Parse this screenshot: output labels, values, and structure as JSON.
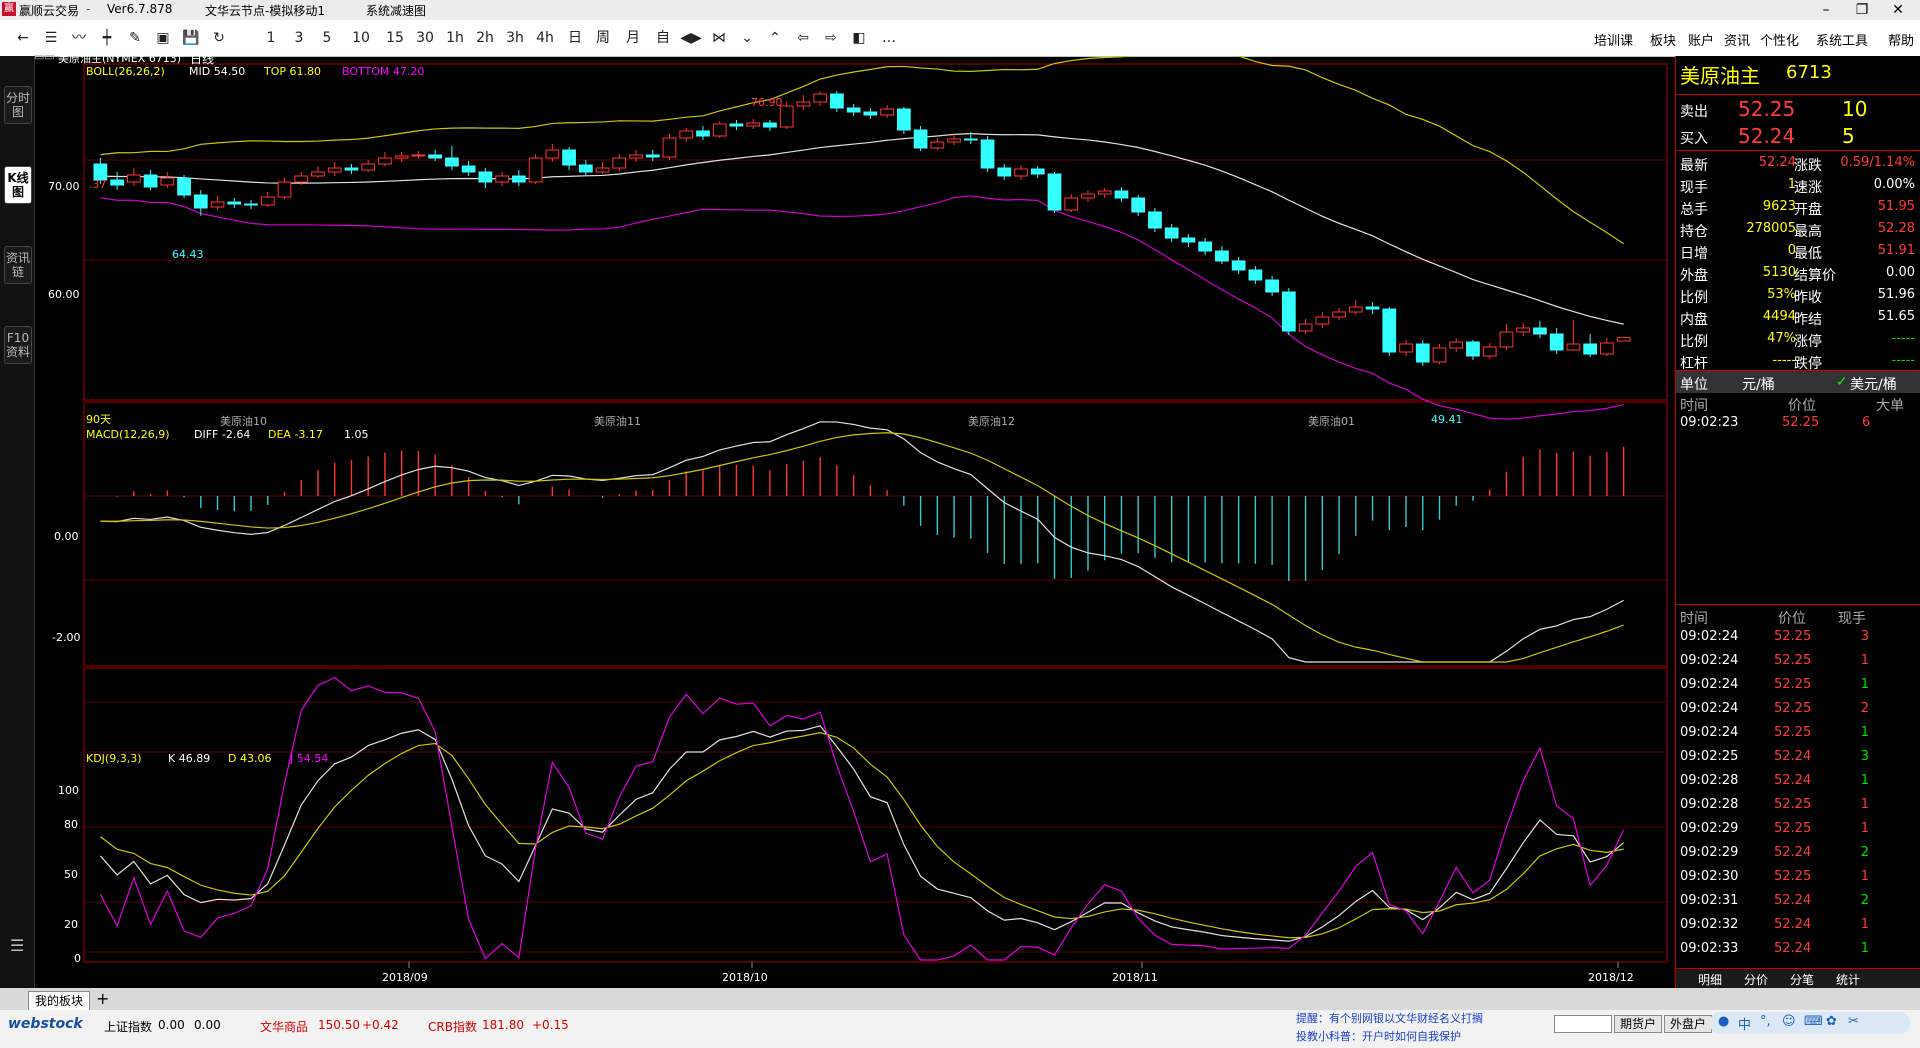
{
  "titlebar": {
    "app_name": "赢顺云交易",
    "version": "Ver6.7.878",
    "node": "文华云节点-模拟移动1",
    "status": "系统减速图"
  },
  "toolbar": {
    "periods": [
      "1",
      "3",
      "5",
      "10",
      "15",
      "30",
      "1h",
      "2h",
      "3h",
      "4h",
      "日",
      "周",
      "月",
      "自"
    ],
    "more": "…",
    "menu": [
      "培训课",
      "板块",
      "账户",
      "资讯",
      "个性化",
      "系统工具",
      "帮助"
    ]
  },
  "left_tabs": [
    "分时图",
    "K线图",
    "资讯链",
    "F10资料"
  ],
  "chart_header": {
    "symbol": "美原油主(NYMEX 6713)",
    "period": "日线"
  },
  "boll": {
    "label": "BOLL(26,26,2)",
    "mid": "MID 54.50",
    "top": "TOP 61.80",
    "bottom": "BOTTOM 47.20"
  },
  "macd": {
    "label": "MACD(12,26,9)",
    "diff": "DIFF -2.64",
    "dea": "DEA -3.17",
    "val": "1.05"
  },
  "kdj": {
    "label": "KDJ(9,3,3)",
    "k": "K 46.89",
    "d": "D 43.06",
    "j": "J 54.54"
  },
  "price_labels": {
    "y70": "70.00",
    "y60": "60.00",
    "hi": "76.90",
    "lo1": "64.43",
    "lo2": "49.41",
    "left": ".37",
    "days": "90天"
  },
  "contract_labels": [
    "美原油10",
    "美原油11",
    "美原油12",
    "美原油01"
  ],
  "macd_axis": [
    "0.00",
    "-2.00"
  ],
  "kdj_axis": [
    "100",
    "80",
    "50",
    "20",
    "0"
  ],
  "date_axis": [
    "2018/09",
    "2018/10",
    "2018/11",
    "2018/12"
  ],
  "quote": {
    "name": "美原油主",
    "code": "6713",
    "sell_label": "卖出",
    "sell_price": "52.25",
    "sell_vol": "10",
    "buy_label": "买入",
    "buy_price": "52.24",
    "buy_vol": "5",
    "rows": [
      [
        "最新",
        "52.24",
        "涨跌",
        "0.59/1.14%"
      ],
      [
        "现手",
        "1",
        "速涨",
        "0.00%"
      ],
      [
        "总手",
        "9623",
        "开盘",
        "51.95"
      ],
      [
        "持仓",
        "278005",
        "最高",
        "52.28"
      ],
      [
        "日增",
        "0",
        "最低",
        "51.91"
      ],
      [
        "外盘",
        "5130",
        "结算价",
        "0.00"
      ],
      [
        "比例",
        "53%",
        "昨收",
        "51.96"
      ],
      [
        "内盘",
        "4494",
        "昨结",
        "51.65"
      ],
      [
        "比例",
        "47%",
        "涨停",
        "-----"
      ],
      [
        "杠杆",
        "-----",
        "跌停",
        "-----"
      ]
    ],
    "unit_label": "单位",
    "unit1": "元/桶",
    "unit2": "美元/桶"
  },
  "big_trade": {
    "headers": [
      "时间",
      "价位",
      "大单"
    ],
    "rows": [
      [
        "09:02:23",
        "52.25",
        "6"
      ]
    ]
  },
  "ticks": {
    "headers": [
      "时间",
      "价位",
      "现手"
    ],
    "rows": [
      [
        "09:02:24",
        "52.25",
        "3",
        "r"
      ],
      [
        "09:02:24",
        "52.25",
        "1",
        "r"
      ],
      [
        "09:02:24",
        "52.25",
        "1",
        "g"
      ],
      [
        "09:02:24",
        "52.25",
        "2",
        "r"
      ],
      [
        "09:02:24",
        "52.25",
        "1",
        "g"
      ],
      [
        "09:02:25",
        "52.24",
        "3",
        "g"
      ],
      [
        "09:02:28",
        "52.24",
        "1",
        "g"
      ],
      [
        "09:02:28",
        "52.25",
        "1",
        "r"
      ],
      [
        "09:02:29",
        "52.25",
        "1",
        "r"
      ],
      [
        "09:02:29",
        "52.24",
        "2",
        "g"
      ],
      [
        "09:02:30",
        "52.25",
        "1",
        "r"
      ],
      [
        "09:02:31",
        "52.24",
        "2",
        "g"
      ],
      [
        "09:02:32",
        "52.24",
        "1",
        "r"
      ],
      [
        "09:02:33",
        "52.24",
        "1",
        "g"
      ]
    ]
  },
  "right_tabs": [
    "明细",
    "分价",
    "分笔",
    "统计"
  ],
  "bottom": {
    "tab": "我的板块",
    "add": "+",
    "brand": "webstock",
    "indexes": [
      {
        "name": "上证指数",
        "value": "0.00",
        "chg": "0.00"
      },
      {
        "name": "文华商品",
        "value": "150.50",
        "chg": "+0.42"
      },
      {
        "name": "CRB指数",
        "value": "181.80",
        "chg": "+0.15"
      }
    ],
    "notice1": "提醒：有个别网银以文华财经名义打搁",
    "notice2": "投教小科普：开户时如何自我保护",
    "btn1": "期货户",
    "btn2": "外盘户",
    "tray": [
      "中",
      "°,",
      "☺",
      "⌨",
      "✿",
      "✂"
    ]
  },
  "chart_data": {
    "type": "candlestick",
    "candles": [
      [
        69.6,
        68.0,
        70.2,
        67.6
      ],
      [
        68.0,
        67.5,
        68.8,
        67.0
      ],
      [
        67.8,
        68.5,
        69.2,
        67.4
      ],
      [
        68.5,
        67.3,
        69.0,
        67.0
      ],
      [
        67.5,
        68.2,
        68.8,
        67.2
      ],
      [
        68.2,
        66.5,
        68.5,
        66.2
      ],
      [
        66.5,
        65.2,
        67.0,
        64.43
      ],
      [
        65.3,
        65.8,
        66.4,
        65.0
      ],
      [
        65.8,
        65.6,
        66.2,
        65.2
      ],
      [
        65.6,
        65.5,
        66.0,
        65.1
      ],
      [
        65.5,
        66.3,
        66.8,
        65.3
      ],
      [
        66.3,
        67.8,
        68.2,
        66.1
      ],
      [
        67.8,
        68.4,
        68.8,
        67.5
      ],
      [
        68.4,
        68.8,
        69.4,
        68.2
      ],
      [
        68.8,
        69.2,
        69.8,
        68.4
      ],
      [
        69.2,
        69.0,
        69.6,
        68.6
      ],
      [
        69.0,
        69.6,
        70.0,
        68.8
      ],
      [
        69.6,
        70.2,
        70.8,
        69.4
      ],
      [
        70.2,
        70.4,
        70.8,
        69.8
      ],
      [
        70.4,
        70.5,
        70.9,
        70.1
      ],
      [
        70.5,
        70.2,
        71.0,
        69.9
      ],
      [
        70.2,
        69.4,
        71.4,
        69.0
      ],
      [
        69.4,
        68.8,
        69.9,
        68.4
      ],
      [
        68.8,
        67.8,
        69.2,
        67.2
      ],
      [
        67.8,
        68.4,
        68.8,
        67.4
      ],
      [
        68.4,
        67.8,
        69.0,
        67.4
      ],
      [
        67.8,
        70.2,
        70.6,
        67.6
      ],
      [
        70.2,
        71.0,
        71.6,
        69.8
      ],
      [
        71.0,
        69.5,
        71.3,
        69.0
      ],
      [
        69.5,
        68.8,
        70.0,
        68.4
      ],
      [
        68.8,
        69.2,
        69.8,
        68.6
      ],
      [
        69.2,
        70.2,
        70.6,
        68.9
      ],
      [
        70.2,
        70.5,
        71.0,
        69.8
      ],
      [
        70.5,
        70.3,
        71.0,
        69.9
      ],
      [
        70.3,
        72.2,
        72.6,
        70.0
      ],
      [
        72.2,
        72.9,
        73.2,
        71.8
      ],
      [
        72.9,
        72.4,
        73.4,
        72.0
      ],
      [
        72.4,
        73.6,
        73.9,
        72.2
      ],
      [
        73.6,
        73.4,
        74.0,
        73.0
      ],
      [
        73.4,
        73.7,
        74.1,
        73.1
      ],
      [
        73.7,
        73.3,
        74.0,
        72.9
      ],
      [
        73.3,
        75.4,
        75.8,
        73.1
      ],
      [
        75.4,
        75.8,
        76.5,
        75.0
      ],
      [
        75.8,
        76.6,
        76.9,
        75.4
      ],
      [
        76.6,
        75.2,
        76.9,
        74.8
      ],
      [
        75.2,
        74.8,
        75.6,
        74.4
      ],
      [
        74.8,
        74.5,
        75.2,
        74.1
      ],
      [
        74.5,
        75.1,
        75.5,
        74.2
      ],
      [
        75.1,
        73.0,
        75.3,
        72.6
      ],
      [
        73.0,
        71.2,
        73.4,
        70.9
      ],
      [
        71.2,
        71.8,
        72.2,
        71.0
      ],
      [
        71.8,
        72.1,
        72.6,
        71.5
      ],
      [
        72.1,
        72.0,
        72.8,
        71.6
      ],
      [
        72.0,
        69.2,
        72.4,
        68.8
      ],
      [
        69.2,
        68.4,
        69.6,
        68.0
      ],
      [
        68.4,
        69.1,
        69.5,
        68.0
      ],
      [
        69.1,
        68.6,
        69.4,
        68.2
      ],
      [
        68.6,
        65.0,
        68.8,
        64.7
      ],
      [
        65.0,
        66.2,
        66.6,
        64.8
      ],
      [
        66.2,
        66.6,
        67.0,
        65.8
      ],
      [
        66.6,
        66.9,
        67.2,
        66.2
      ],
      [
        66.9,
        66.2,
        67.3,
        65.8
      ],
      [
        66.2,
        64.8,
        66.5,
        64.4
      ],
      [
        64.8,
        63.2,
        65.2,
        62.8
      ],
      [
        63.2,
        62.2,
        63.6,
        61.8
      ],
      [
        62.2,
        61.8,
        62.6,
        61.3
      ],
      [
        61.8,
        60.9,
        62.2,
        60.5
      ],
      [
        60.9,
        59.9,
        61.4,
        59.6
      ],
      [
        59.9,
        59.0,
        60.3,
        58.6
      ],
      [
        59.0,
        58.0,
        59.4,
        57.6
      ],
      [
        58.0,
        56.8,
        58.4,
        56.4
      ],
      [
        56.8,
        52.9,
        57.2,
        52.5
      ],
      [
        52.9,
        53.6,
        54.1,
        52.6
      ],
      [
        53.6,
        54.3,
        54.8,
        53.2
      ],
      [
        54.3,
        54.8,
        55.2,
        54.0
      ],
      [
        54.8,
        55.3,
        56.0,
        54.5
      ],
      [
        55.3,
        55.1,
        55.8,
        54.6
      ],
      [
        55.1,
        50.8,
        55.3,
        50.4
      ],
      [
        50.8,
        51.6,
        52.0,
        50.4
      ],
      [
        51.6,
        49.8,
        52.0,
        49.41
      ],
      [
        49.8,
        51.2,
        51.6,
        49.6
      ],
      [
        51.2,
        51.8,
        52.2,
        50.8
      ],
      [
        51.8,
        50.4,
        52.0,
        50.0
      ],
      [
        50.4,
        51.3,
        51.7,
        50.1
      ],
      [
        51.3,
        52.8,
        53.6,
        51.0
      ],
      [
        52.8,
        53.2,
        53.7,
        52.4
      ],
      [
        53.2,
        52.6,
        53.9,
        52.2
      ],
      [
        52.6,
        51.0,
        53.2,
        50.6
      ],
      [
        51.0,
        51.6,
        54.0,
        51.2
      ],
      [
        51.6,
        50.6,
        52.6,
        50.3
      ],
      [
        50.6,
        51.7,
        52.2,
        50.4
      ],
      [
        51.9,
        52.24,
        52.28,
        51.91
      ]
    ],
    "boll_mid_start": 68.4,
    "ylim": [
      46.0,
      78.0
    ]
  }
}
